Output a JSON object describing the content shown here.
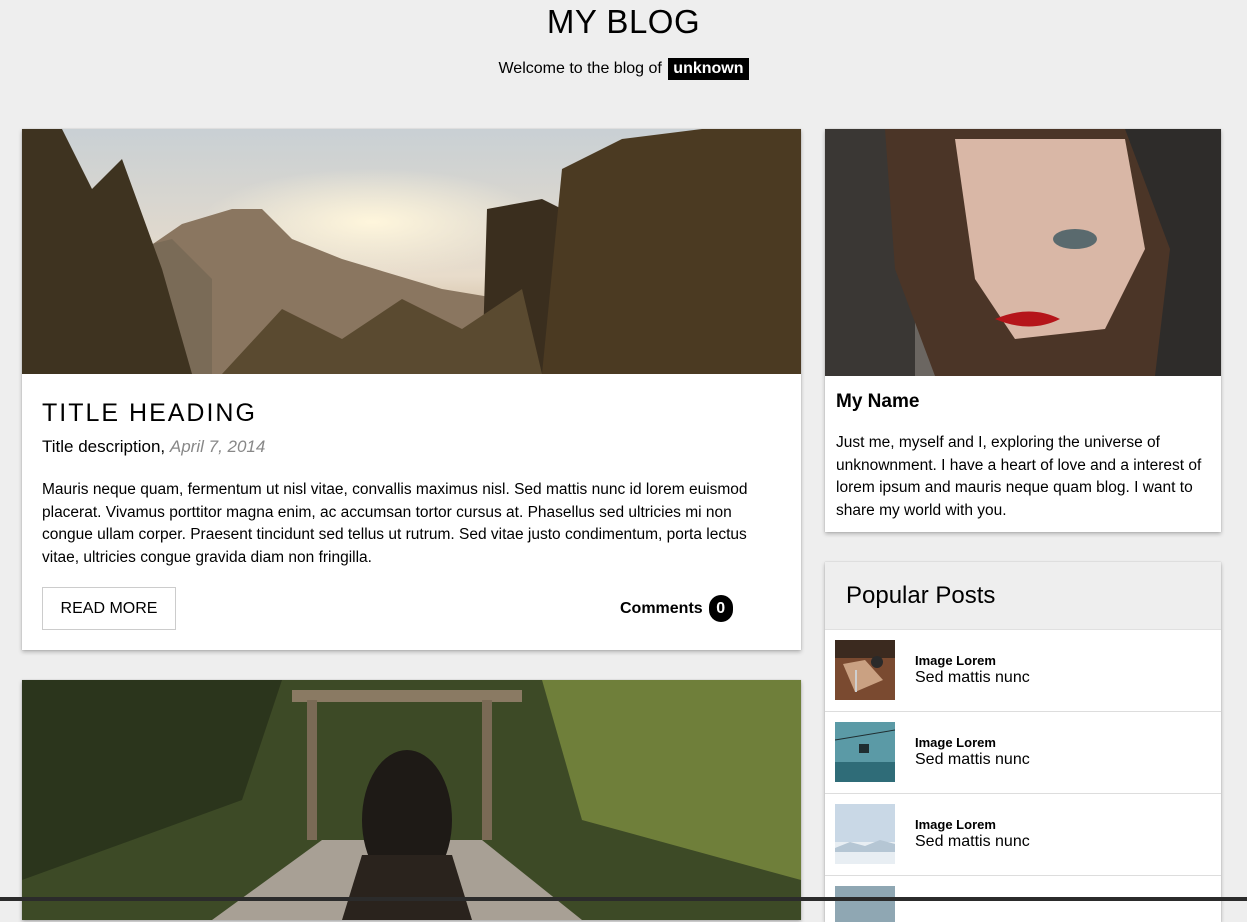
{
  "header": {
    "title": "MY BLOG",
    "welcome_text": "Welcome to the blog of",
    "author_tag": "unknown"
  },
  "post": {
    "title": "TITLE HEADING",
    "description": "Title description,",
    "date": "April 7, 2014",
    "body": "Mauris neque quam, fermentum ut nisl vitae, convallis maximus nisl. Sed mattis nunc id lorem euismod placerat. Vivamus porttitor magna enim, ac accumsan tortor cursus at. Phasellus sed ultricies mi non congue ullam corper. Praesent tincidunt sed tellus ut rutrum. Sed vitae justo condimentum, porta lectus vitae, ultricies congue gravida diam non fringilla.",
    "read_more_label": "READ MORE",
    "comments_label": "Comments",
    "comments_count": "0"
  },
  "profile": {
    "name": "My Name",
    "bio": "Just me, myself and I, exploring the universe of unknownment. I have a heart of love and a interest of lorem ipsum and mauris neque quam blog. I want to share my world with you."
  },
  "popular": {
    "title": "Popular Posts",
    "items": [
      {
        "heading": "Image Lorem",
        "text": "Sed mattis nunc",
        "image": "workshop-tools-image"
      },
      {
        "heading": "Image Lorem",
        "text": "Sed mattis nunc",
        "image": "cable-car-image"
      },
      {
        "heading": "Image Lorem",
        "text": "Sed mattis nunc",
        "image": "snowy-mountains-image"
      }
    ]
  },
  "colors": {
    "page_background": "#eeeeee",
    "card_background": "#ffffff",
    "badge_background": "#000000",
    "date_text": "#888888"
  }
}
